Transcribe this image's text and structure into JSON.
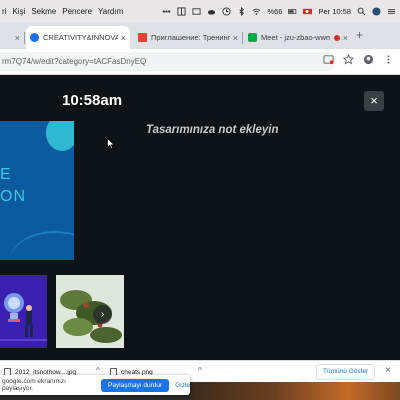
{
  "menubar": {
    "items": [
      "ri",
      "Kişi",
      "Sekme",
      "Pencere",
      "Yardım"
    ],
    "battery": "%66",
    "clock": "Per 10:58"
  },
  "tabs": [
    {
      "label": "",
      "favicon_color": "#e8c547"
    },
    {
      "label": "CREATIVITY&INNOVATION",
      "favicon_color": "#1a73e8"
    },
    {
      "label": "Приглашение: Тренинг \"Кре",
      "favicon_color": "#ea4335"
    },
    {
      "label": "Meet - jzu-zbao-wwm",
      "favicon_color": "#00ac47"
    }
  ],
  "addressbar": {
    "url": "rm7Q74/w/edit?category=tACFasDnyEQ"
  },
  "presenter": {
    "time": "10:58am",
    "close_label": "×",
    "notes_placeholder": "Tasarımınıza not ekleyin",
    "slide_text_line1": "E",
    "slide_text_line2": "ON",
    "next_arrow": "›"
  },
  "downloads": {
    "items": [
      {
        "name": "2012_itsnothow....jpg"
      },
      {
        "name": "cheats.png"
      }
    ],
    "show_all_label": "Tümünü Göster",
    "close_label": "×"
  },
  "sharebar": {
    "message": "google.com ekranınızı paylaşıyor.",
    "stop_label": "Paylaşmayı durdur",
    "hide_label": "Gizle"
  }
}
